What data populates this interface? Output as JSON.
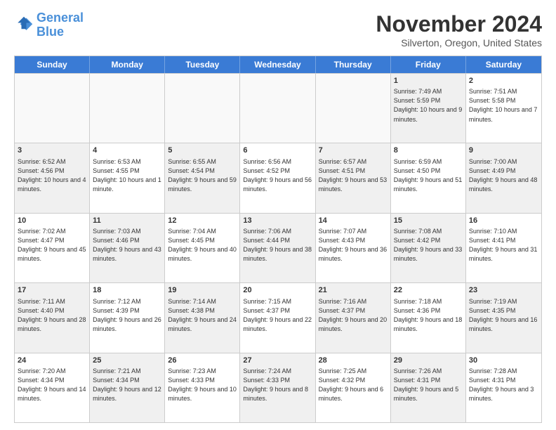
{
  "logo": {
    "line1": "General",
    "line2": "Blue"
  },
  "title": "November 2024",
  "location": "Silverton, Oregon, United States",
  "header": {
    "days": [
      "Sunday",
      "Monday",
      "Tuesday",
      "Wednesday",
      "Thursday",
      "Friday",
      "Saturday"
    ]
  },
  "rows": [
    [
      {
        "day": "",
        "info": "",
        "empty": true
      },
      {
        "day": "",
        "info": "",
        "empty": true
      },
      {
        "day": "",
        "info": "",
        "empty": true
      },
      {
        "day": "",
        "info": "",
        "empty": true
      },
      {
        "day": "",
        "info": "",
        "empty": true
      },
      {
        "day": "1",
        "info": "Sunrise: 7:49 AM\nSunset: 5:59 PM\nDaylight: 10 hours and 9 minutes.",
        "empty": false,
        "shaded": true
      },
      {
        "day": "2",
        "info": "Sunrise: 7:51 AM\nSunset: 5:58 PM\nDaylight: 10 hours and 7 minutes.",
        "empty": false,
        "shaded": false
      }
    ],
    [
      {
        "day": "3",
        "info": "Sunrise: 6:52 AM\nSunset: 4:56 PM\nDaylight: 10 hours and 4 minutes.",
        "empty": false,
        "shaded": true
      },
      {
        "day": "4",
        "info": "Sunrise: 6:53 AM\nSunset: 4:55 PM\nDaylight: 10 hours and 1 minute.",
        "empty": false,
        "shaded": false
      },
      {
        "day": "5",
        "info": "Sunrise: 6:55 AM\nSunset: 4:54 PM\nDaylight: 9 hours and 59 minutes.",
        "empty": false,
        "shaded": true
      },
      {
        "day": "6",
        "info": "Sunrise: 6:56 AM\nSunset: 4:52 PM\nDaylight: 9 hours and 56 minutes.",
        "empty": false,
        "shaded": false
      },
      {
        "day": "7",
        "info": "Sunrise: 6:57 AM\nSunset: 4:51 PM\nDaylight: 9 hours and 53 minutes.",
        "empty": false,
        "shaded": true
      },
      {
        "day": "8",
        "info": "Sunrise: 6:59 AM\nSunset: 4:50 PM\nDaylight: 9 hours and 51 minutes.",
        "empty": false,
        "shaded": false
      },
      {
        "day": "9",
        "info": "Sunrise: 7:00 AM\nSunset: 4:49 PM\nDaylight: 9 hours and 48 minutes.",
        "empty": false,
        "shaded": true
      }
    ],
    [
      {
        "day": "10",
        "info": "Sunrise: 7:02 AM\nSunset: 4:47 PM\nDaylight: 9 hours and 45 minutes.",
        "empty": false,
        "shaded": false
      },
      {
        "day": "11",
        "info": "Sunrise: 7:03 AM\nSunset: 4:46 PM\nDaylight: 9 hours and 43 minutes.",
        "empty": false,
        "shaded": true
      },
      {
        "day": "12",
        "info": "Sunrise: 7:04 AM\nSunset: 4:45 PM\nDaylight: 9 hours and 40 minutes.",
        "empty": false,
        "shaded": false
      },
      {
        "day": "13",
        "info": "Sunrise: 7:06 AM\nSunset: 4:44 PM\nDaylight: 9 hours and 38 minutes.",
        "empty": false,
        "shaded": true
      },
      {
        "day": "14",
        "info": "Sunrise: 7:07 AM\nSunset: 4:43 PM\nDaylight: 9 hours and 36 minutes.",
        "empty": false,
        "shaded": false
      },
      {
        "day": "15",
        "info": "Sunrise: 7:08 AM\nSunset: 4:42 PM\nDaylight: 9 hours and 33 minutes.",
        "empty": false,
        "shaded": true
      },
      {
        "day": "16",
        "info": "Sunrise: 7:10 AM\nSunset: 4:41 PM\nDaylight: 9 hours and 31 minutes.",
        "empty": false,
        "shaded": false
      }
    ],
    [
      {
        "day": "17",
        "info": "Sunrise: 7:11 AM\nSunset: 4:40 PM\nDaylight: 9 hours and 28 minutes.",
        "empty": false,
        "shaded": true
      },
      {
        "day": "18",
        "info": "Sunrise: 7:12 AM\nSunset: 4:39 PM\nDaylight: 9 hours and 26 minutes.",
        "empty": false,
        "shaded": false
      },
      {
        "day": "19",
        "info": "Sunrise: 7:14 AM\nSunset: 4:38 PM\nDaylight: 9 hours and 24 minutes.",
        "empty": false,
        "shaded": true
      },
      {
        "day": "20",
        "info": "Sunrise: 7:15 AM\nSunset: 4:37 PM\nDaylight: 9 hours and 22 minutes.",
        "empty": false,
        "shaded": false
      },
      {
        "day": "21",
        "info": "Sunrise: 7:16 AM\nSunset: 4:37 PM\nDaylight: 9 hours and 20 minutes.",
        "empty": false,
        "shaded": true
      },
      {
        "day": "22",
        "info": "Sunrise: 7:18 AM\nSunset: 4:36 PM\nDaylight: 9 hours and 18 minutes.",
        "empty": false,
        "shaded": false
      },
      {
        "day": "23",
        "info": "Sunrise: 7:19 AM\nSunset: 4:35 PM\nDaylight: 9 hours and 16 minutes.",
        "empty": false,
        "shaded": true
      }
    ],
    [
      {
        "day": "24",
        "info": "Sunrise: 7:20 AM\nSunset: 4:34 PM\nDaylight: 9 hours and 14 minutes.",
        "empty": false,
        "shaded": false
      },
      {
        "day": "25",
        "info": "Sunrise: 7:21 AM\nSunset: 4:34 PM\nDaylight: 9 hours and 12 minutes.",
        "empty": false,
        "shaded": true
      },
      {
        "day": "26",
        "info": "Sunrise: 7:23 AM\nSunset: 4:33 PM\nDaylight: 9 hours and 10 minutes.",
        "empty": false,
        "shaded": false
      },
      {
        "day": "27",
        "info": "Sunrise: 7:24 AM\nSunset: 4:33 PM\nDaylight: 9 hours and 8 minutes.",
        "empty": false,
        "shaded": true
      },
      {
        "day": "28",
        "info": "Sunrise: 7:25 AM\nSunset: 4:32 PM\nDaylight: 9 hours and 6 minutes.",
        "empty": false,
        "shaded": false
      },
      {
        "day": "29",
        "info": "Sunrise: 7:26 AM\nSunset: 4:31 PM\nDaylight: 9 hours and 5 minutes.",
        "empty": false,
        "shaded": true
      },
      {
        "day": "30",
        "info": "Sunrise: 7:28 AM\nSunset: 4:31 PM\nDaylight: 9 hours and 3 minutes.",
        "empty": false,
        "shaded": false
      }
    ]
  ]
}
